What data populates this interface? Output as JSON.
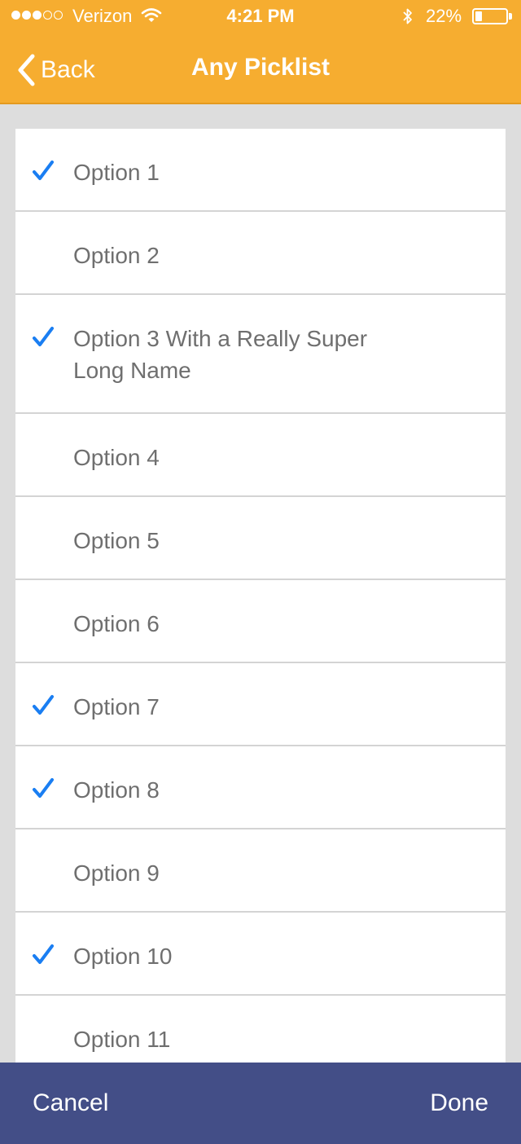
{
  "status_bar": {
    "carrier": "Verizon",
    "time": "4:21 PM",
    "battery_percent": "22%",
    "battery_level": 0.22,
    "signal_bars_filled": 3,
    "signal_bars_total": 5
  },
  "nav": {
    "back_label": "Back",
    "title": "Any Picklist"
  },
  "options": [
    {
      "label": "Option 1",
      "checked": true
    },
    {
      "label": "Option 2",
      "checked": false
    },
    {
      "label": "Option 3 With a Really Super Long Name",
      "checked": true
    },
    {
      "label": "Option 4",
      "checked": false
    },
    {
      "label": "Option 5",
      "checked": false
    },
    {
      "label": "Option 6",
      "checked": false
    },
    {
      "label": "Option 7",
      "checked": true
    },
    {
      "label": "Option 8",
      "checked": true
    },
    {
      "label": "Option 9",
      "checked": false
    },
    {
      "label": "Option 10",
      "checked": true
    },
    {
      "label": "Option 11",
      "checked": false
    }
  ],
  "footer": {
    "cancel_label": "Cancel",
    "done_label": "Done"
  },
  "colors": {
    "header": "#f6ad30",
    "footer": "#434e87",
    "checkmark": "#1a7ef2",
    "background": "#dddddd"
  },
  "icons": {
    "back": "chevron-left-icon",
    "check": "checkmark-icon",
    "wifi": "wifi-icon",
    "bluetooth": "bluetooth-icon",
    "battery": "battery-icon"
  }
}
